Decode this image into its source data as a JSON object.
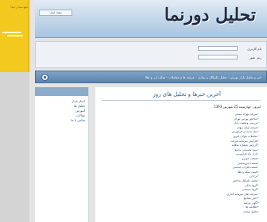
{
  "ad": {
    "top_text": "تبلیغ شما در اینجا"
  },
  "header": {
    "logo": "تحلیل دورنما",
    "link": "صفحه اصلی"
  },
  "login": {
    "username_label": "نام کاربری",
    "password_label": "رمز عبور"
  },
  "nav": {
    "text": "خبر و تحلیل بازار بورس - تحلیل تکنیکال و بنیادی - عرضه ها و معاملات - سکه، ارز و طلا"
  },
  "sidebar": {
    "items": [
      "اخبار بازار",
      "تحلیل ها",
      "آموزش",
      "مقالات",
      "تماس با ما"
    ]
  },
  "main": {
    "title": "آخرین خبرها و تحلیل های روز",
    "date": "امروز: چهارشنبه 25 شهریور 1393",
    "news": [
      "شرکت بهزاد شیمی",
      "شاخص بورس تهران",
      "بررسی وضعیت بازار",
      "عرضه اولیه سهام",
      "نماد جدید در فرابورس",
      "معاملات بلوکی امروز",
      "افزایش سرمایه شرکت",
      "گزارش عملکرد ماهانه",
      "سود تقسیمی مجمع",
      "بازار پایه فرابورس",
      "صنعت خودرو",
      "صنعت پتروشیمی",
      "صنعت فلزات اساسی",
      "قیمت سکه و طلا",
      "نرخ ارز",
      "تحلیل تکنیکال شاخص",
      "گروه بانکی",
      "گروه سیمانی",
      "شرکت های سرمایه گذاری",
      "اخبار مجامع",
      "آگهی عرضه",
      "اطلاعیه ها",
      "تحلیل بنیادی"
    ]
  }
}
